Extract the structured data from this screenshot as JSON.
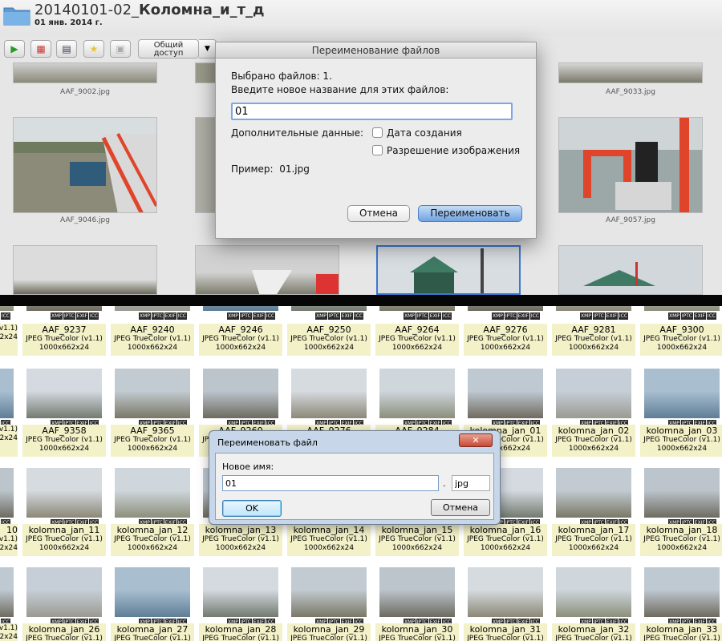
{
  "mac": {
    "folder_title_prefix": "20140101-02_",
    "folder_title_bold": "Коломна_и_т_д",
    "folder_date": "01 янв. 2014 г.",
    "share_label_line1": "Общий",
    "share_label_line2": "доступ",
    "thumb_captions": [
      "AAF_9002.jpg",
      "AAF_9033.jpg",
      "AAF_9046.jpg",
      "AAF_9057.jpg"
    ],
    "dialog": {
      "title": "Переименование файлов",
      "selected_text": "Выбрано файлов: 1.",
      "prompt_text": "Введите новое название для этих файлов:",
      "name_value": "01",
      "extra_label": "Дополнительные данные:",
      "checkbox_date_label": "Дата создания",
      "checkbox_resolution_label": "Разрешение изображения",
      "example_label": "Пример:",
      "example_value": "01.jpg",
      "cancel_label": "Отмена",
      "rename_label": "Переименовать"
    }
  },
  "win": {
    "badge_labels": [
      "XMP",
      "IPTC",
      "EXIF",
      "ICC"
    ],
    "file_type": "JPEG TrueColor (v1.1)",
    "file_size": "1000x662x24",
    "row1_names": [
      "AAF_9237",
      "AAF_9240",
      "AAF_9246",
      "AAF_9250",
      "AAF_9264",
      "AAF_9276",
      "AAF_9281",
      "AAF_9300"
    ],
    "row2_names": [
      "AAF_9358",
      "AAF_9365",
      "AAF_9260",
      "AAF_9276",
      "AAF_9284",
      "kolomna_jan_01",
      "kolomna_jan_02",
      "kolomna_jan_03"
    ],
    "row3_names": [
      "kolomna_jan_11",
      "kolomna_jan_12",
      "kolomna_jan_13",
      "kolomna_jan_14",
      "kolomna_jan_15",
      "kolomna_jan_16",
      "kolomna_jan_17",
      "kolomna_jan_18"
    ],
    "row4_names": [
      "kolomna_jan_26",
      "kolomna_jan_27",
      "kolomna_jan_28",
      "kolomna_jan_29",
      "kolomna_jan_30",
      "kolomna_jan_31",
      "kolomna_jan_32",
      "kolomna_jan_33"
    ],
    "left_partial_numbers": [
      "10"
    ],
    "dialog": {
      "title": "Переименовать файл",
      "close_label": "✕",
      "new_name_label": "Новое имя:",
      "name_value": "01",
      "dot": ".",
      "ext_value": "jpg",
      "ok_label": "OK",
      "cancel_label": "Отмена"
    }
  },
  "colors": {
    "cell_bg": "#f3f1c8",
    "mac_default_button": "#6fa3e3",
    "win_close": "#c84a34"
  }
}
